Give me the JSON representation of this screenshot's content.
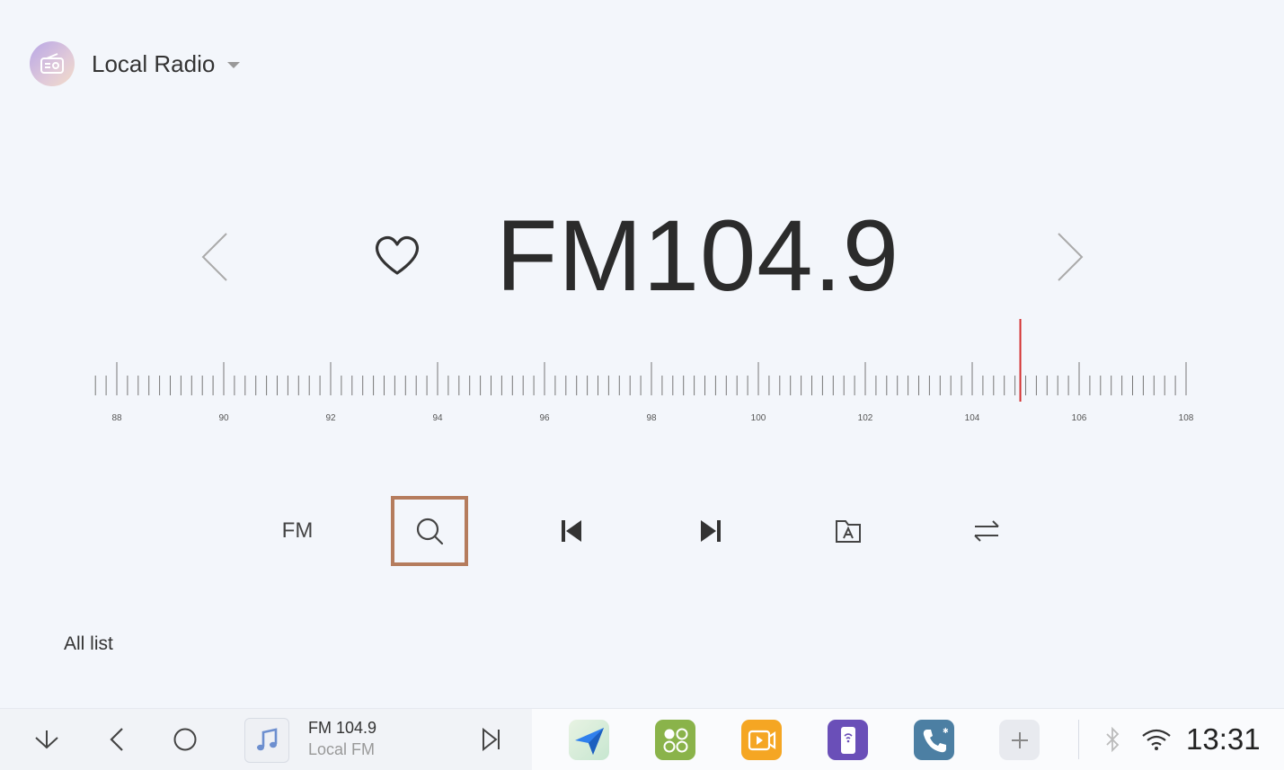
{
  "header": {
    "app_icon": "radio-icon",
    "title": "Local Radio",
    "dropdown_icon": "caret-down-icon"
  },
  "station": {
    "frequency_display": "FM104.9",
    "current_frequency": 104.9,
    "favorite_icon": "heart-outline-icon",
    "prev_icon": "chevron-left-icon",
    "next_icon": "chevron-right-icon"
  },
  "tuner": {
    "min": 88,
    "max": 108,
    "tick_labels": [
      "88",
      "90",
      "92",
      "94",
      "96",
      "98",
      "100",
      "102",
      "104",
      "106",
      "108"
    ],
    "indicator_color": "#d32f2f"
  },
  "controls": {
    "band_label": "FM",
    "search_icon": "search-icon",
    "prev_station_icon": "skip-previous-icon",
    "next_station_icon": "skip-next-icon",
    "preset_icon": "folder-a-icon",
    "switch_icon": "swap-arrows-icon",
    "selected_color": "#b57c5d"
  },
  "list": {
    "label": "All list"
  },
  "taskbar": {
    "down_icon": "chevron-down-icon",
    "back_icon": "back-icon",
    "home_icon": "home-circle-icon",
    "media_icon": "music-note-icon",
    "media_title": "FM 104.9",
    "media_subtitle": "Local FM",
    "media_next_icon": "skip-next-outline-icon",
    "apps": [
      {
        "name": "navigation-app-icon",
        "color": "#7ccc8c"
      },
      {
        "name": "apps-grid-app-icon",
        "color": "#8ab34a"
      },
      {
        "name": "video-app-icon",
        "color": "#f5a623"
      },
      {
        "name": "phone-link-app-icon",
        "color": "#6a4fb8"
      },
      {
        "name": "phone-app-icon",
        "color": "#4c7fa3"
      },
      {
        "name": "add-app-icon",
        "color": "#e8eaef"
      }
    ],
    "bluetooth_icon": "bluetooth-icon",
    "wifi_icon": "wifi-icon",
    "clock": "13:31"
  }
}
